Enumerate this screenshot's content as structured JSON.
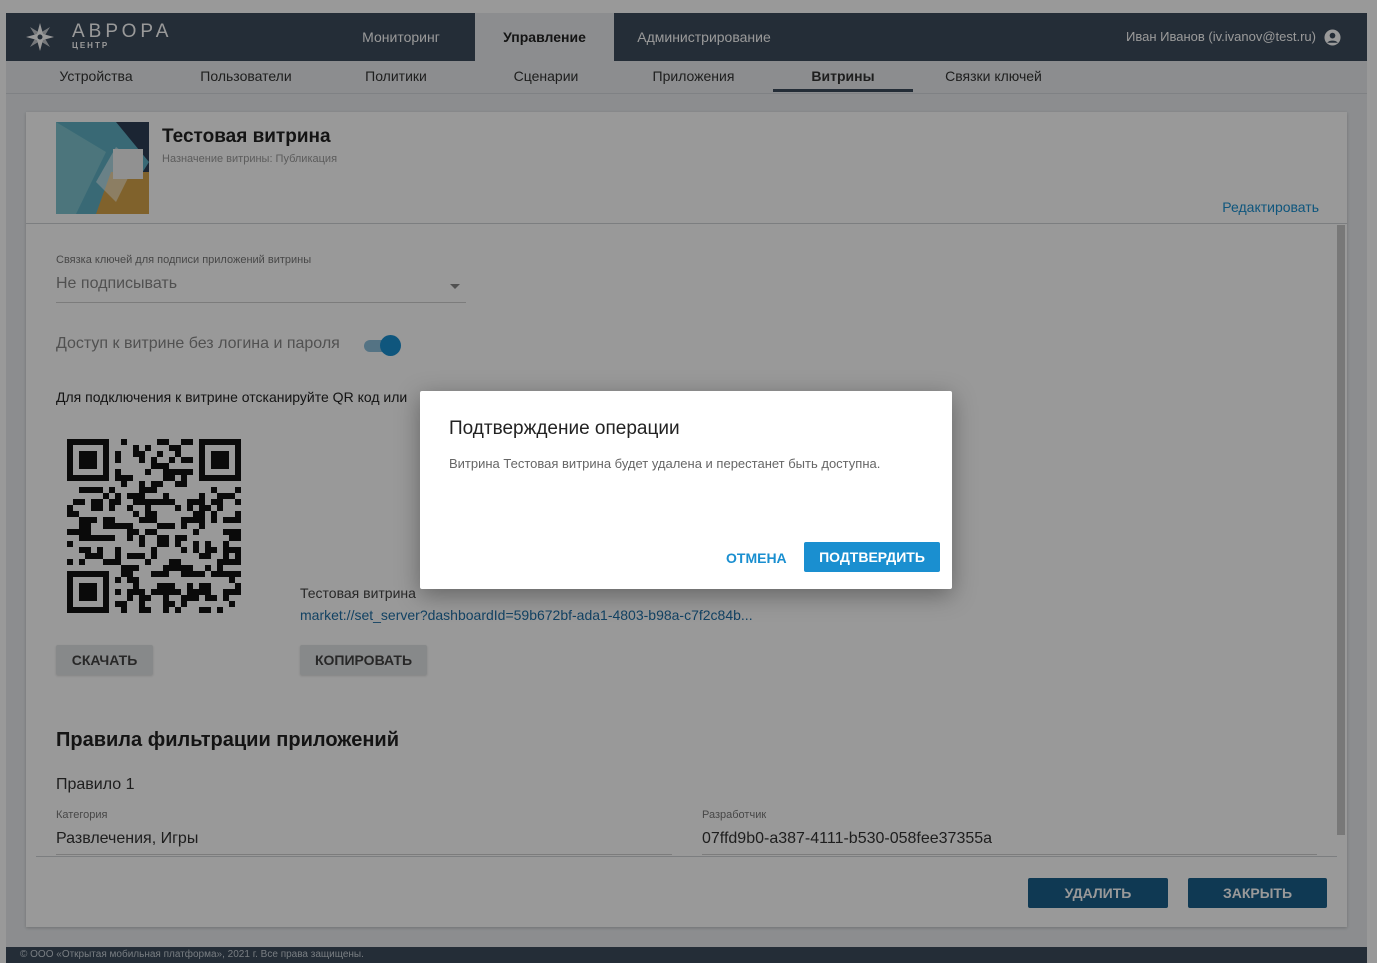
{
  "header": {
    "logo_main": "АВРОРА",
    "logo_sub": "ЦЕНТР",
    "tabs": [
      {
        "label": "Мониторинг"
      },
      {
        "label": "Управление"
      },
      {
        "label": "Администрирование"
      }
    ],
    "user_label": "Иван Иванов (iv.ivanov@test.ru)"
  },
  "subnav": {
    "items": [
      {
        "label": "Устройства"
      },
      {
        "label": "Пользователи"
      },
      {
        "label": "Политики"
      },
      {
        "label": "Сценарии"
      },
      {
        "label": "Приложения"
      },
      {
        "label": "Витрины"
      },
      {
        "label": "Связки ключей"
      }
    ]
  },
  "showcase": {
    "title": "Тестовая витрина",
    "purpose": "Назначение витрины: Публикация",
    "edit_label": "Редактировать",
    "keychain_label": "Связка ключей для подписи приложений витрины",
    "keychain_value": "Не подписывать",
    "access_label": "Доступ к витрине без логина и пароля",
    "access_enabled": true,
    "qr_instruction": "Для подключения к витрине отсканируйте QR код или",
    "qr_name": "Тестовая витрина",
    "qr_link": "market://set_server?dashboardId=59b672bf-ada1-4803-b98a-c7f2c84b...",
    "download_label": "СКАЧАТЬ",
    "copy_label": "КОПИРОВАТЬ",
    "filter_section_title": "Правила фильтрации приложений",
    "rule_title": "Правило 1",
    "category_label": "Категория",
    "category_value": "Развлечения, Игры",
    "developer_label": "Разработчик",
    "developer_value": "07ffd9b0-a387-4111-b530-058fee37355a",
    "delete_label": "УДАЛИТЬ",
    "close_label": "ЗАКРЫТЬ"
  },
  "footer": {
    "text": "© ООО «Открытая мобильная платформа», 2021 г. Все права защищены."
  },
  "dialog": {
    "title": "Подтверждение операции",
    "message": "Витрина Тестовая витрина будет удалена и перестанет быть доступна.",
    "cancel_label": "ОТМЕНА",
    "confirm_label": "ПОДТВЕРДИТЬ"
  },
  "colors": {
    "header_bg": "#3c4b5c",
    "accent": "#1a8fd0",
    "button_dark": "#1a5f8a",
    "page_bg": "#e9ecef"
  },
  "icons": {
    "logo": "aurora-logo-icon",
    "user": "user-account-icon",
    "dropdown": "chevron-down-icon"
  }
}
